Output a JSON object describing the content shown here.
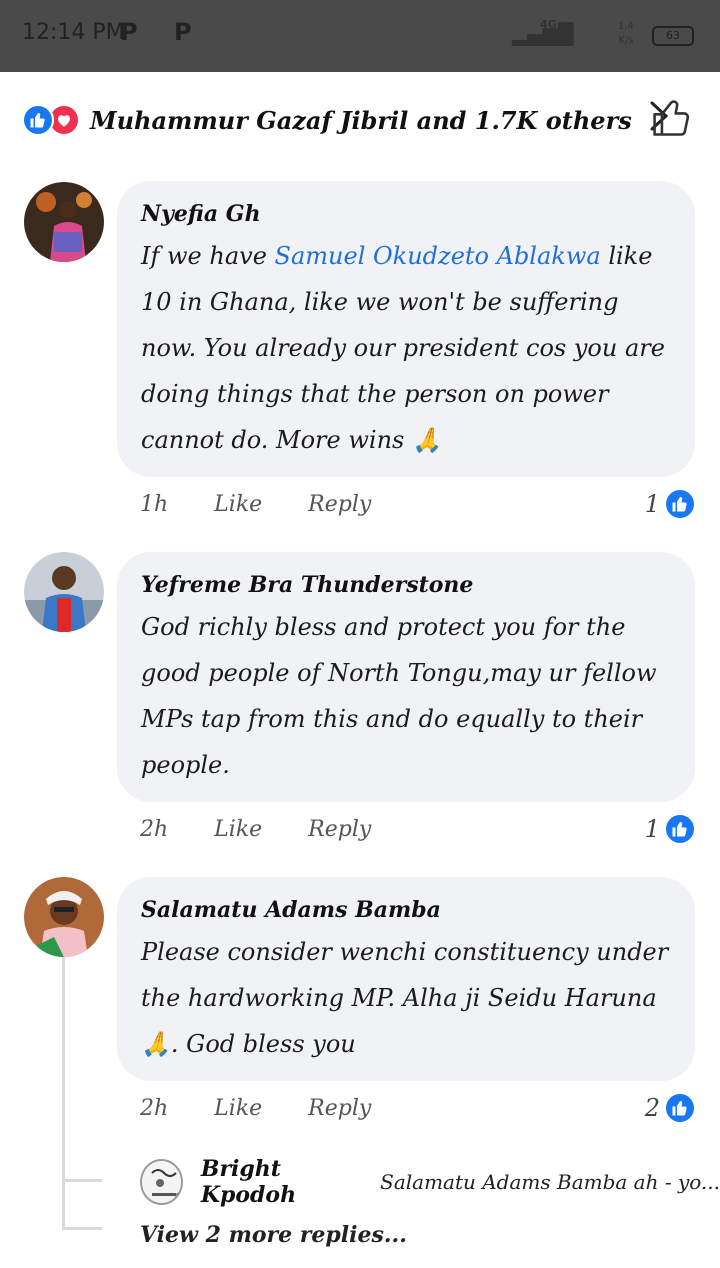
{
  "status_bar": {
    "time": "12:14 PM",
    "app_icons": "P P",
    "network": "4G",
    "speed_top": "1.4",
    "speed_bottom": "K/s",
    "battery": "63"
  },
  "reactions": {
    "names": "Muhammur Gazaf Jibril and 1.7K others"
  },
  "comments": [
    {
      "name": "Nyefia Gh",
      "text_before": "If we have ",
      "mention": "Samuel Okudzeto Ablakwa",
      "text_after": " like 10 in Ghana, like we won't be suffering now. You already our president cos you are doing things that the person on power cannot do. More wins 🙏",
      "time": "1h",
      "like": "Like",
      "reply": "Reply",
      "like_count": "1"
    },
    {
      "name": "Yefreme Bra Thunderstone",
      "text": "God richly bless and protect you for the good people of North Tongu,may ur fellow MPs tap from this and do equally to their people.",
      "time": "2h",
      "like": "Like",
      "reply": "Reply",
      "like_count": "1"
    },
    {
      "name": "Salamatu Adams Bamba",
      "text": "Please consider wenchi constituency under the hardworking MP. Alha ji Seidu Haruna 🙏. God bless you",
      "time": "2h",
      "like": "Like",
      "reply": "Reply",
      "like_count": "2"
    }
  ],
  "reply": {
    "name": "Bright Kpodoh",
    "text": "Salamatu Adams Bamba ah - yo..."
  },
  "more_replies": "View 2 more replies...",
  "colors": {
    "like_blue": "#1877f2",
    "love_red": "#f0304f",
    "mention_blue": "#216fdb",
    "bubble_bg": "#f0f2f5"
  }
}
